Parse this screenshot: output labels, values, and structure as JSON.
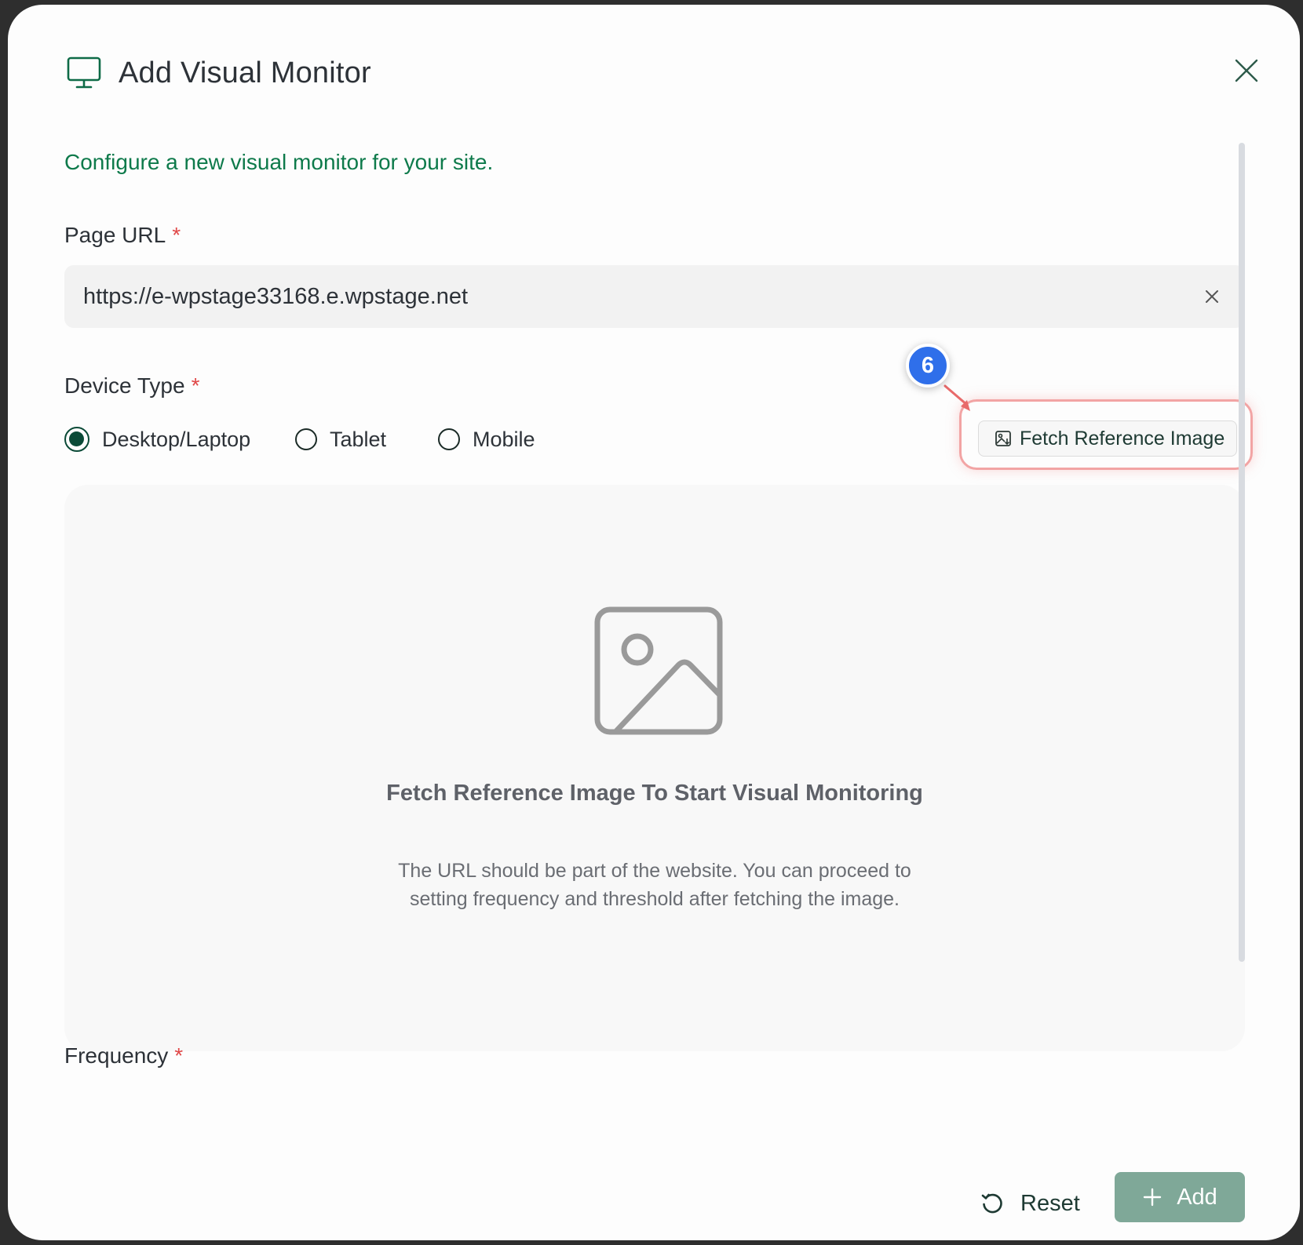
{
  "dialog": {
    "title": "Add Visual Monitor",
    "subtitle": "Configure a new visual monitor for your site.",
    "icons": {
      "header": "monitor-icon",
      "close": "close-icon"
    }
  },
  "page_url": {
    "label": "Page URL",
    "required_mark": "*",
    "value": "https://e-wpstage33168.e.wpstage.net"
  },
  "device_type": {
    "label": "Device Type",
    "required_mark": "*",
    "options": [
      {
        "label": "Desktop/Laptop",
        "selected": true
      },
      {
        "label": "Tablet",
        "selected": false
      },
      {
        "label": "Mobile",
        "selected": false
      }
    ]
  },
  "fetch_button": {
    "label": "Fetch Reference Image",
    "icon": "image-download-icon"
  },
  "annotation": {
    "step_number": "6",
    "colors": {
      "badge": "#2f6fea",
      "highlight": "#f2a4a4"
    }
  },
  "preview": {
    "title": "Fetch Reference Image To Start Visual Monitoring",
    "description": "The URL should be part of the website. You can proceed to setting frequency and threshold after fetching the image.",
    "icon": "image-placeholder-icon"
  },
  "frequency": {
    "label": "Frequency",
    "required_mark": "*"
  },
  "footer": {
    "reset_label": "Reset",
    "add_label": "Add"
  },
  "colors": {
    "accent": "#0e7a4b",
    "radio_selected": "#0b4a37",
    "required": "#e04848",
    "add_button": "#7fa898"
  }
}
